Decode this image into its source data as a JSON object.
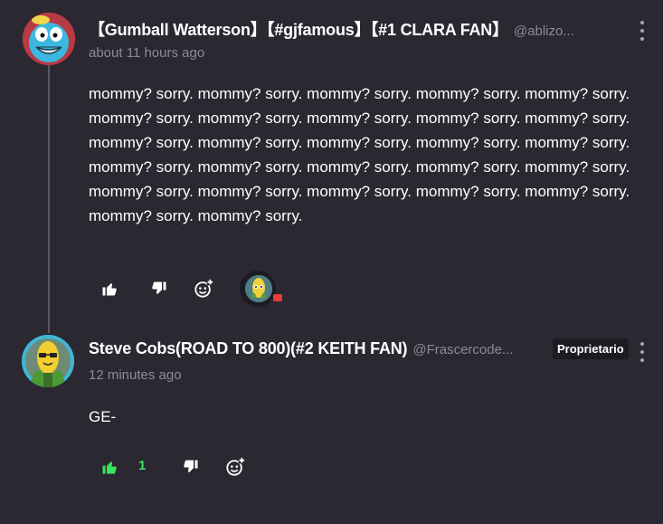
{
  "comments": [
    {
      "author": "【Gumball Watterson】【#gjfamous】【#1 CLARA FAN】",
      "handle": "@ablizo...",
      "time": "about 11 hours ago",
      "body": "mommy? sorry. mommy? sorry. mommy? sorry. mommy? sorry. mommy? sorry. mommy? sorry. mommy? sorry. mommy? sorry. mommy? sorry. mommy? sorry. mommy? sorry. mommy? sorry. mommy? sorry. mommy? sorry. mommy? sorry. mommy? sorry. mommy? sorry. mommy? sorry. mommy? sorry. mommy? sorry. mommy? sorry. mommy? sorry. mommy? sorry. mommy? sorry. mommy? sorry. mommy? sorry. mommy? sorry.",
      "icons": {
        "like": "thumbs-up-icon",
        "dislike": "thumbs-down-icon",
        "react": "add-reaction-icon",
        "menu": "more-vertical-icon",
        "reaction": "corn-emoji"
      }
    },
    {
      "author": "Steve Cobs(ROAD TO 800)(#2 KEITH FAN)",
      "handle": "@Frascercode...",
      "badge": "Proprietario",
      "time": "12 minutes ago",
      "body": "GE-",
      "likes": "1",
      "icons": {
        "like": "thumbs-up-icon",
        "dislike": "thumbs-down-icon",
        "react": "add-reaction-icon",
        "menu": "more-vertical-icon"
      }
    }
  ],
  "colors": {
    "background": "#2b2831",
    "muted_text": "#8e8a96",
    "liked_green": "#38e45e",
    "badge_bg": "#1d1b22"
  }
}
